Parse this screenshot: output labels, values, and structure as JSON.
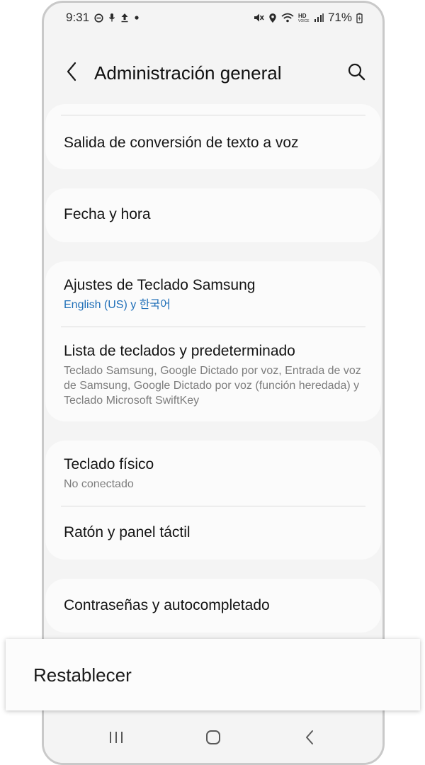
{
  "status_bar": {
    "time": "9:31",
    "battery": "71%"
  },
  "header": {
    "title": "Administración general"
  },
  "items": [
    {
      "title": "Salida de conversión de texto a voz"
    },
    {
      "title": "Fecha y hora"
    },
    {
      "title": "Ajustes de Teclado Samsung",
      "subtitle": "English (US) y 한국어"
    },
    {
      "title": "Lista de teclados y predeterminado",
      "subtitle": "Teclado Samsung, Google Dictado por voz, Entrada de voz de Samsung, Google Dictado por voz (función heredada) y Teclado Microsoft SwiftKey"
    },
    {
      "title": "Teclado físico",
      "subtitle": "No conectado"
    },
    {
      "title": "Ratón y panel táctil"
    },
    {
      "title": "Contraseñas y autocompletado"
    }
  ],
  "highlight": {
    "label": "Restablecer"
  },
  "colors": {
    "accent_link": "#1f6fb8",
    "background": "#f4f4f4",
    "card": "#fbfbfb"
  },
  "icons": {
    "back": "chevron-left-icon",
    "search": "search-icon",
    "nav_recents": "recents-icon",
    "nav_home": "home-icon",
    "nav_back": "back-icon"
  }
}
